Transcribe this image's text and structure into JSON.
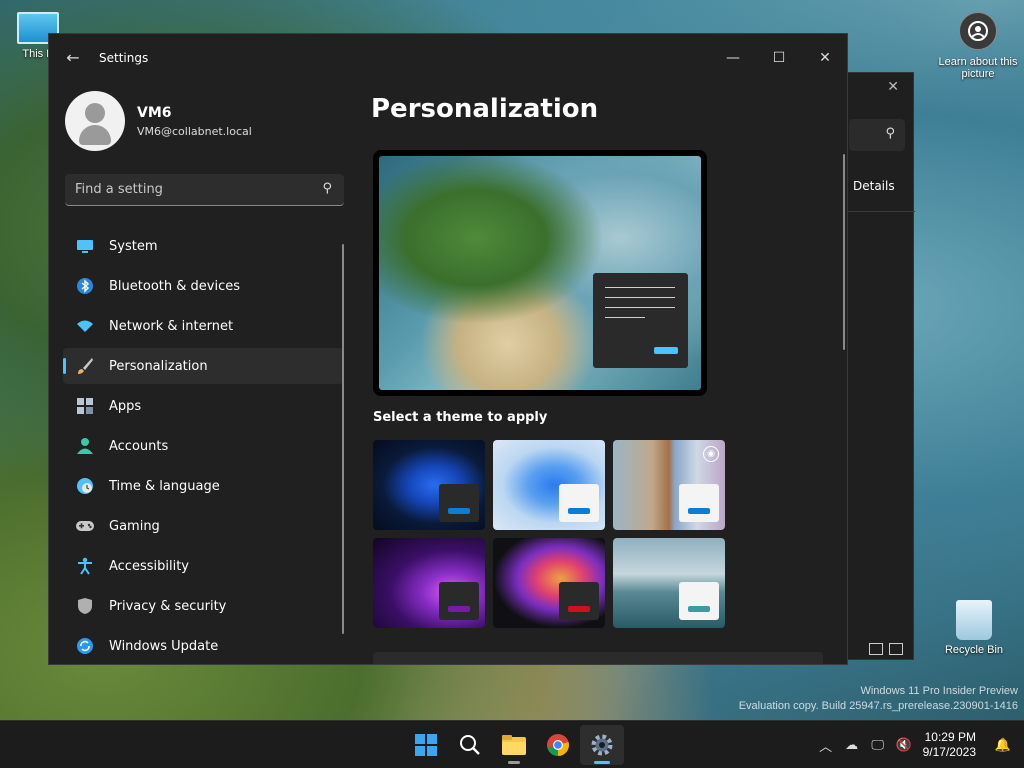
{
  "desktop": {
    "pc_label": "This P",
    "learn_label": "Learn about this picture",
    "bin_label": "Recycle Bin",
    "watermark_line1": "Windows 11 Pro Insider Preview",
    "watermark_line2": "Evaluation copy. Build 25947.rs_prerelease.230901-1416"
  },
  "bg_window": {
    "close": "✕",
    "details": "Details"
  },
  "window": {
    "title": "Settings",
    "back": "←",
    "min": "—",
    "max": "☐",
    "close": "✕"
  },
  "profile": {
    "name": "VM6",
    "email": "VM6@collabnet.local"
  },
  "search": {
    "placeholder": "Find a setting",
    "icon": "search-icon"
  },
  "nav": {
    "items": [
      {
        "label": "System",
        "icon": "system-icon",
        "color": "#4cc2ff"
      },
      {
        "label": "Bluetooth & devices",
        "icon": "bluetooth-icon",
        "color": "#2b88d8"
      },
      {
        "label": "Network & internet",
        "icon": "wifi-icon",
        "color": "#4cc2ff"
      },
      {
        "label": "Personalization",
        "icon": "brush-icon",
        "color": "#e8b06a",
        "active": true
      },
      {
        "label": "Apps",
        "icon": "apps-icon",
        "color": "#b8c7d6"
      },
      {
        "label": "Accounts",
        "icon": "accounts-icon",
        "color": "#3cc8a8"
      },
      {
        "label": "Time & language",
        "icon": "globe-icon",
        "color": "#4cc2ff"
      },
      {
        "label": "Gaming",
        "icon": "gamepad-icon",
        "color": "#c8c8c8"
      },
      {
        "label": "Accessibility",
        "icon": "accessibility-icon",
        "color": "#4cc2ff"
      },
      {
        "label": "Privacy & security",
        "icon": "shield-icon",
        "color": "#b0b0b0"
      },
      {
        "label": "Windows Update",
        "icon": "update-icon",
        "color": "#2b9ae8"
      }
    ]
  },
  "main": {
    "title": "Personalization",
    "theme_heading": "Select a theme to apply"
  },
  "themes": [
    {
      "name": "windows-dark-theme",
      "style": "dark",
      "accent": "#0a7ed6"
    },
    {
      "name": "windows-light-theme",
      "style": "light",
      "accent": "#0a7ed6"
    },
    {
      "name": "windows-spotlight-theme",
      "style": "light",
      "accent": "#0a7ed6"
    },
    {
      "name": "glow-theme",
      "style": "dark",
      "accent": "#7a1aa8"
    },
    {
      "name": "captured-motion-theme",
      "style": "dark",
      "accent": "#d0101a"
    },
    {
      "name": "flow-theme",
      "style": "light",
      "accent": "#3a9aa6"
    }
  ],
  "taskbar": {
    "apps": [
      "start-icon",
      "search-icon",
      "file-explorer-icon",
      "chrome-icon",
      "settings-icon"
    ],
    "time": "10:29 PM",
    "date": "9/17/2023"
  }
}
